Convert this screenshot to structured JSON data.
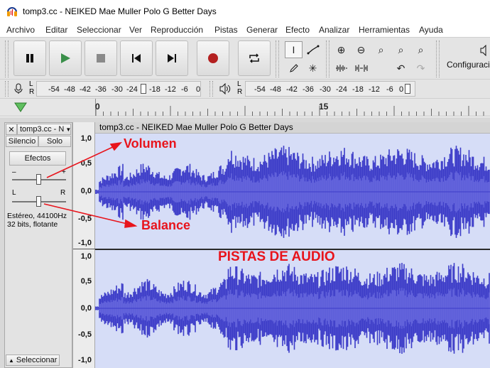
{
  "window": {
    "title": "tomp3.cc - NEIKED Mae Muller Polo G  Better Days"
  },
  "menu": [
    "Archivo",
    "Editar",
    "Seleccionar",
    "Ver",
    "Reproducción",
    "Pistas",
    "Generar",
    "Efecto",
    "Analizar",
    "Herramientas",
    "Ayuda"
  ],
  "toolbar": {
    "config_label": "Configuraci"
  },
  "meters": {
    "record_channels": "L R",
    "play_channels": "L R",
    "ticks": [
      "-54",
      "-48",
      "-42",
      "-36",
      "-30",
      "-24",
      "-18",
      "-12",
      "-6",
      "0"
    ]
  },
  "timeline": {
    "labels": [
      "0",
      "15"
    ]
  },
  "track": {
    "name": "tomp3.cc - N",
    "mute_label": "Silencio",
    "solo_label": "Solo",
    "effects_label": "Efectos",
    "gain_minus": "–",
    "gain_plus": "+",
    "pan_left": "L",
    "pan_right": "R",
    "info_line1": "Estéreo, 44100Hz",
    "info_line2": "32 bits, flotante",
    "select_label": "Seleccionar",
    "clip_title": "tomp3.cc - NEIKED Mae Muller Polo G  Better Days"
  },
  "vruler": {
    "top": [
      "1,0",
      "0,5",
      "0,0",
      "-0,5",
      "-1,0"
    ],
    "bottom": [
      "1,0",
      "0,5",
      "0,0",
      "-0,5",
      "-1,0"
    ]
  },
  "annotations": {
    "volume": "Volumen",
    "balance": "Balance",
    "tracks": "PISTAS DE AUDIO"
  },
  "colors": {
    "waveform": "#3c3cc8",
    "waveform_rms": "#6464dc",
    "annotation": "#e8141c",
    "record_button": "#b42020",
    "play_button": "#3a8f4a"
  }
}
